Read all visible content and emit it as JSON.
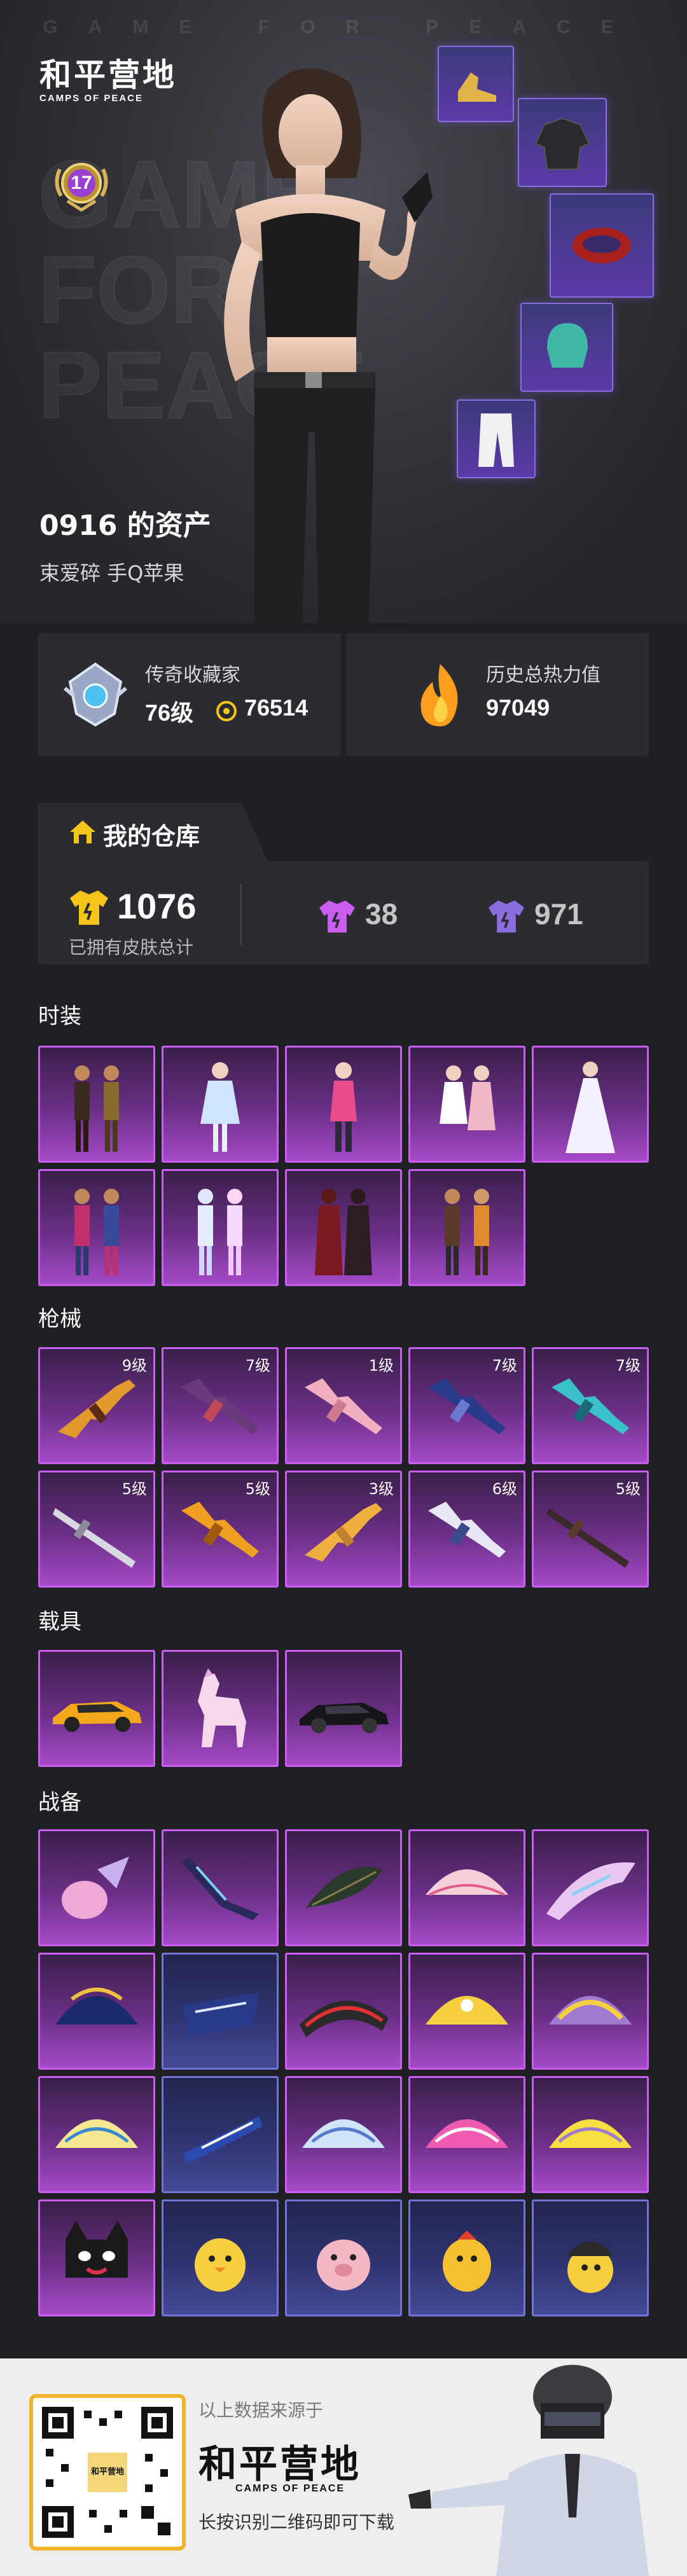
{
  "hero": {
    "watermark_top": "GAME FOR PEACE",
    "watermark_big": [
      "GAME",
      "FOR",
      "PEACE"
    ],
    "logo_cn": "和平营地",
    "logo_en": "CAMPS OF PEACE",
    "level": "17",
    "player_name": "0916 的资产",
    "player_sub": "束爱碎 手Q苹果"
  },
  "stats": {
    "collector": {
      "title": "传奇收藏家",
      "level": "76级",
      "score": "76514",
      "icon": "collector-badge-icon"
    },
    "popularity": {
      "title": "历史总热力值",
      "value": "97049",
      "icon": "flame-icon"
    }
  },
  "warehouse": {
    "tab_label": "我的仓库",
    "total": "1076",
    "total_label": "已拥有皮肤总计",
    "rare_count": "38",
    "epic_count": "971"
  },
  "sections": {
    "fashion": "时装",
    "weapons": "枪械",
    "vehicles": "载具",
    "gear": "战备"
  },
  "weapon_levels": [
    "9级",
    "7级",
    "1级",
    "7级",
    "7级",
    "5级",
    "5级",
    "3级",
    "6级",
    "5级"
  ],
  "footer": {
    "source": "以上数据来源于",
    "brand": "和平营地",
    "brand_en": "CAMPS OF PEACE",
    "scan": "长按识别二维码即可下载",
    "qr_center": "和平营地"
  },
  "colors": {
    "legendary_gold": "#f5c518",
    "epic_purple": "#c95ef0",
    "rare_blue": "#6f74d6",
    "flame": "#ff9d1c"
  }
}
